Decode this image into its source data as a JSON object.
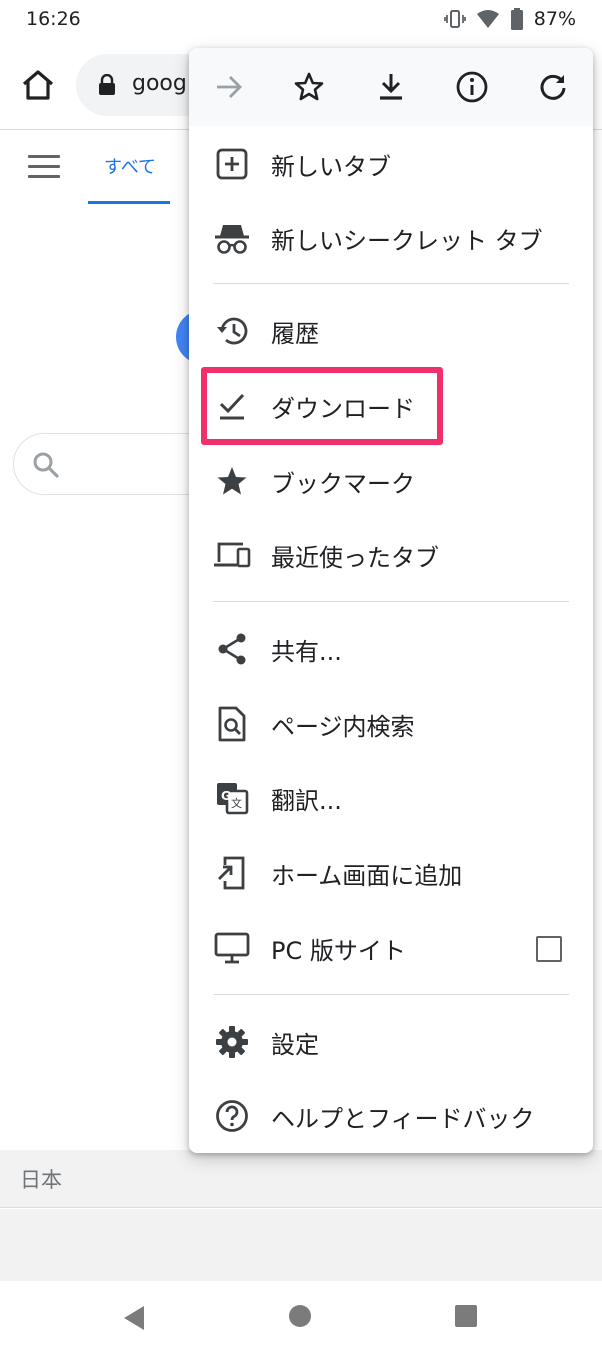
{
  "status_bar": {
    "time": "16:26",
    "battery": "87%"
  },
  "omnibox": {
    "url": "goog"
  },
  "page": {
    "tab_all": "すべて",
    "footer_country": "日本"
  },
  "menu": {
    "items": [
      {
        "label": "新しいタブ",
        "icon": "new-tab-icon"
      },
      {
        "label": "新しいシークレット タブ",
        "icon": "incognito-icon"
      },
      {
        "label": "履歴",
        "icon": "history-icon"
      },
      {
        "label": "ダウンロード",
        "icon": "downloads-icon"
      },
      {
        "label": "ブックマーク",
        "icon": "bookmarks-icon"
      },
      {
        "label": "最近使ったタブ",
        "icon": "recent-tabs-icon"
      },
      {
        "label": "共有...",
        "icon": "share-icon"
      },
      {
        "label": "ページ内検索",
        "icon": "find-in-page-icon"
      },
      {
        "label": "翻訳...",
        "icon": "translate-icon"
      },
      {
        "label": "ホーム画面に追加",
        "icon": "add-to-home-icon"
      },
      {
        "label": "PC 版サイト",
        "icon": "desktop-icon",
        "checked": false
      },
      {
        "label": "設定",
        "icon": "settings-icon"
      },
      {
        "label": "ヘルプとフィードバック",
        "icon": "help-icon"
      }
    ]
  },
  "colors": {
    "accent": "#1a73e8",
    "highlight": "#f0306a",
    "icon": "#3c4043"
  }
}
